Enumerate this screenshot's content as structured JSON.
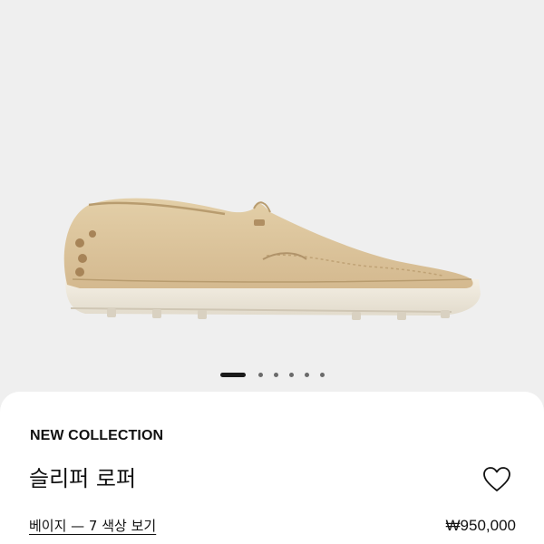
{
  "gallery": {
    "slide_count": 7,
    "active_index": 0,
    "image": {
      "subject": "beige suede loafer with white sole"
    }
  },
  "product": {
    "collection_label": "NEW COLLECTION",
    "title": "슬리퍼 로퍼",
    "color_link": "베이지 — 7 색상 보기",
    "price": "₩950,000",
    "wishlist_icon": "heart-outline-icon"
  },
  "colors": {
    "background": "#efefef",
    "sheet": "#ffffff",
    "text": "#111111",
    "suede": "#dcc39a"
  }
}
